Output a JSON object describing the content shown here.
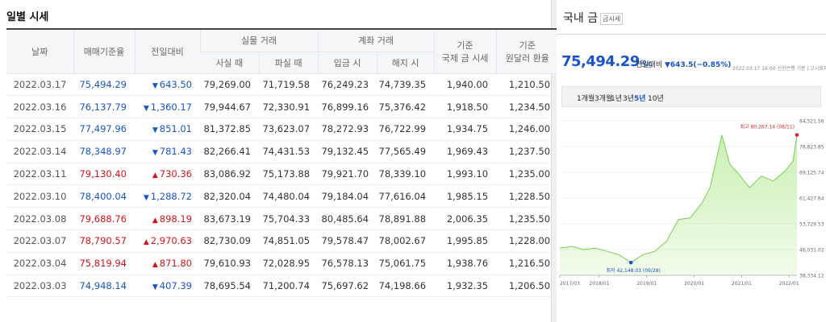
{
  "left": {
    "title": "일별 시세",
    "headers": {
      "date": "날짜",
      "base": "매매기준율",
      "change": "전일대비",
      "physical": "실물 거래",
      "buy": "사실 때",
      "sell": "파실 때",
      "account": "계좌 거래",
      "deposit": "입금 시",
      "withdraw": "해지 시",
      "intl_l1": "기준",
      "intl_l2": "국제 금 시세",
      "fx_l1": "기준",
      "fx_l2": "원달러 환율"
    },
    "rows": [
      {
        "date": "2022.03.17",
        "base": "75,494.29",
        "dir": "down",
        "change": "643.50",
        "buy": "79,269.00",
        "sell": "71,719.58",
        "deposit": "76,249.23",
        "withdraw": "74,739.35",
        "intl": "1,940.00",
        "fx": "1,210.50"
      },
      {
        "date": "2022.03.16",
        "base": "76,137.79",
        "dir": "down",
        "change": "1,360.17",
        "buy": "79,944.67",
        "sell": "72,330.91",
        "deposit": "76,899.16",
        "withdraw": "75,376.42",
        "intl": "1,918.50",
        "fx": "1,234.50"
      },
      {
        "date": "2022.03.15",
        "base": "77,497.96",
        "dir": "down",
        "change": "851.01",
        "buy": "81,372.85",
        "sell": "73,623.07",
        "deposit": "78,272.93",
        "withdraw": "76,722.99",
        "intl": "1,934.75",
        "fx": "1,246.00"
      },
      {
        "date": "2022.03.14",
        "base": "78,348.97",
        "dir": "down",
        "change": "781.43",
        "buy": "82,266.41",
        "sell": "74,431.53",
        "deposit": "79,132.45",
        "withdraw": "77,565.49",
        "intl": "1,969.43",
        "fx": "1,237.50"
      },
      {
        "date": "2022.03.11",
        "base": "79,130.40",
        "dir": "up",
        "change": "730.36",
        "buy": "83,086.92",
        "sell": "75,173.88",
        "deposit": "79,921.70",
        "withdraw": "78,339.10",
        "intl": "1,993.10",
        "fx": "1,235.00"
      },
      {
        "date": "2022.03.10",
        "base": "78,400.04",
        "dir": "down",
        "change": "1,288.72",
        "buy": "82,320.04",
        "sell": "74,480.04",
        "deposit": "79,184.04",
        "withdraw": "77,616.04",
        "intl": "1,985.15",
        "fx": "1,228.50"
      },
      {
        "date": "2022.03.08",
        "base": "79,688.76",
        "dir": "up",
        "change": "898.19",
        "buy": "83,673.19",
        "sell": "75,704.33",
        "deposit": "80,485.64",
        "withdraw": "78,891.88",
        "intl": "2,006.35",
        "fx": "1,235.50"
      },
      {
        "date": "2022.03.07",
        "base": "78,790.57",
        "dir": "up",
        "change": "2,970.63",
        "buy": "82,730.09",
        "sell": "74,851.05",
        "deposit": "79,578.47",
        "withdraw": "78,002.67",
        "intl": "1,995.85",
        "fx": "1,228.00"
      },
      {
        "date": "2022.03.04",
        "base": "75,819.94",
        "dir": "up",
        "change": "871.80",
        "buy": "79,610.93",
        "sell": "72,028.95",
        "deposit": "76,578.13",
        "withdraw": "75,061.75",
        "intl": "1,938.76",
        "fx": "1,216.50"
      },
      {
        "date": "2022.03.03",
        "base": "74,948.14",
        "dir": "down",
        "change": "407.39",
        "buy": "78,695.54",
        "sell": "71,200.74",
        "deposit": "75,697.62",
        "withdraw": "74,198.66",
        "intl": "1,932.35",
        "fx": "1,206.50"
      }
    ],
    "arrows": {
      "up": "▲",
      "down": "▼"
    },
    "colors": {
      "up": "#d3131a",
      "down": "#1a55c7"
    }
  },
  "right": {
    "title": "국내 금",
    "badge": "금시세",
    "price": "75,494.29",
    "price_unit": "원/g",
    "change_label": "전일대비",
    "change_value": "▼643.5(−0.85%)",
    "meta": "2022.03.17 16:00 신한은행 기준 | 고시회차 148회",
    "tabs": [
      {
        "label": "1개월",
        "active": false
      },
      {
        "label": "3개월",
        "active": false
      },
      {
        "label": "1년",
        "active": false
      },
      {
        "label": "3년",
        "active": false
      },
      {
        "label": "5년",
        "active": true
      },
      {
        "label": "10년",
        "active": false
      }
    ]
  },
  "chart_data": {
    "type": "area",
    "x": [
      "2017/03",
      "2017/06",
      "2017/09",
      "2017/12",
      "2018/03",
      "2018/06",
      "2018/09",
      "2018/12",
      "2019/03",
      "2019/06",
      "2019/09",
      "2019/12",
      "2020/03",
      "2020/05",
      "2020/08",
      "2020/10",
      "2020/12",
      "2021/03",
      "2021/06",
      "2021/09",
      "2021/12",
      "2022/02",
      "2022/03"
    ],
    "y": [
      46500,
      47000,
      46000,
      46500,
      45500,
      44500,
      42148,
      44500,
      45500,
      48500,
      55000,
      55500,
      60000,
      64500,
      80267,
      71500,
      69000,
      64500,
      68000,
      66500,
      69500,
      72500,
      80267
    ],
    "yticks": [
      "84,521.56",
      "76,823.85",
      "69,125.74",
      "61,427.64",
      "53,729.53",
      "46,031.02",
      "38,334.12"
    ],
    "ylim": [
      38334.12,
      84521.56
    ],
    "xticks": [
      "2017/03",
      "2018/01",
      "2019/01",
      "2020/01",
      "2021/01",
      "2022/01"
    ],
    "high_label": "최고 80,267.14 (08/11)",
    "low_label": "최저 42,148.03 (09/28)",
    "high": {
      "x": "2022/03",
      "y": 80267
    },
    "low": {
      "x": "2018/09",
      "y": 42148
    },
    "fill_color": "#c8efb0",
    "line_color": "#7bcf56"
  }
}
